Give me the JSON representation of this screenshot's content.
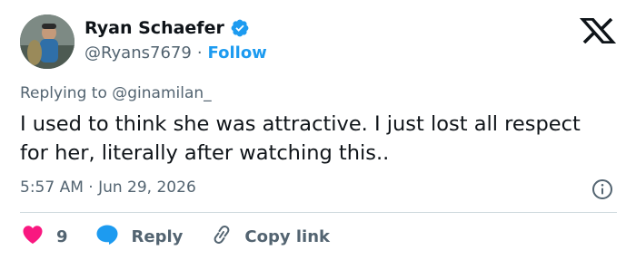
{
  "author": {
    "display_name": "Ryan Schaefer",
    "handle": "@Ryans7679",
    "separator": "·",
    "follow_label": "Follow",
    "verified": true
  },
  "replying": {
    "prefix": "Replying to",
    "mention": "@ginamilan_"
  },
  "tweet": {
    "text": "I used to think she was attractive. I just lost all respect for her, literally after watching this..",
    "timestamp": "5:57 AM · Jun 29, 2026"
  },
  "actions": {
    "like_count": "9",
    "reply_label": "Reply",
    "copy_label": "Copy link"
  },
  "colors": {
    "accent": "#1d9bf0",
    "like": "#f91880",
    "secondary_text": "#536471",
    "primary_text": "#0f1419",
    "divider": "#cfd9de"
  },
  "icons": [
    "verified-badge-icon",
    "x-logo-icon",
    "info-icon",
    "heart-icon",
    "reply-bubble-icon",
    "link-icon"
  ]
}
